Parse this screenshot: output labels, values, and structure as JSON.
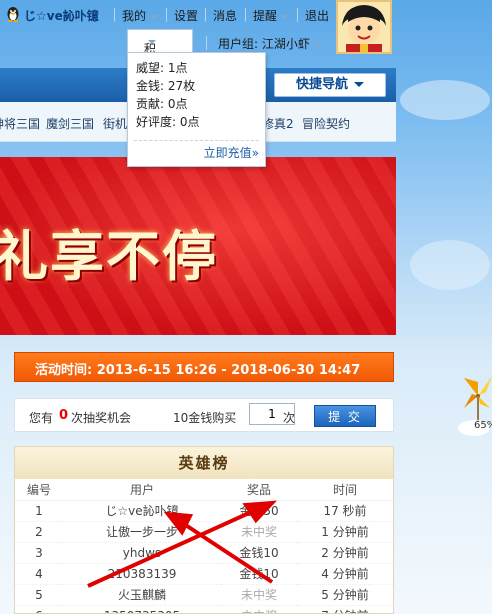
{
  "topbar": {
    "username": "じ☆ve訫卟镱",
    "my": "我的",
    "settings": "设置",
    "messages": "消息",
    "reminders": "提醒",
    "logout": "退出",
    "points": "积分: 6",
    "usergroup": "用户组: 江湖小虾"
  },
  "points_dropdown": {
    "prestige": "威望: 1点",
    "money": "金钱: 27枚",
    "contribution": "贡献: 0点",
    "favor": "好评度: 0点",
    "recharge": "立即充值»"
  },
  "nav": {
    "quick_nav": "快捷导航",
    "games": [
      "神将三国",
      "魔剑三国",
      "街机",
      "修真2",
      "冒险契约"
    ]
  },
  "banner": {
    "title": "礼享不停"
  },
  "activity": {
    "time_text": "活动时间: 2013-6-15 16:26 - 2018-06-30 14:47"
  },
  "lottery": {
    "chance_prefix": "您有",
    "chance_count": "0",
    "chance_suffix": "次抽奖机会",
    "buy_prefix": "10金钱购买",
    "quantity": "1",
    "buy_suffix": "次",
    "submit": "提 交"
  },
  "hero_board": {
    "title": "英雄榜",
    "headers": [
      "编号",
      "用户",
      "奖品",
      "时间"
    ],
    "rows": [
      {
        "no": "1",
        "user": "じ☆ve訫卟镱",
        "prize": "金钱50",
        "time": "17 秒前"
      },
      {
        "no": "2",
        "user": "让傲一步一步",
        "prize": "未中奖",
        "time": "1 分钟前"
      },
      {
        "no": "3",
        "user": "yhdws",
        "prize": "金钱10",
        "time": "2 分钟前"
      },
      {
        "no": "4",
        "user": "210383139",
        "prize": "金钱10",
        "time": "4 分钟前"
      },
      {
        "no": "5",
        "user": "火玉麒麟",
        "prize": "未中奖",
        "time": "5 分钟前"
      },
      {
        "no": "6",
        "user": "1350735305",
        "prize": "未中奖",
        "time": "7 分钟前"
      }
    ]
  },
  "side_widget": {
    "percent": "65%"
  },
  "colors": {
    "accent": "#f25a05",
    "nav": "#1b5ea8",
    "banner": "#d9141b",
    "arrow": "#e00000"
  }
}
